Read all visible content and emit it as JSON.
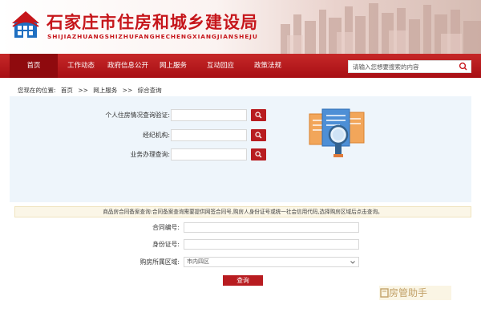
{
  "header": {
    "title": "石家庄市住房和城乡建设局",
    "subtitle": "SHIJIAZHUANGSHIZHUFANGHECHENGXIANGJIANSHEJU"
  },
  "nav": {
    "items": [
      {
        "label": "首页",
        "active": true
      },
      {
        "label": "工作动态"
      },
      {
        "label": "政府信息公开"
      },
      {
        "label": "网上服务"
      },
      {
        "label": "互动回应"
      },
      {
        "label": "政策法规"
      }
    ],
    "search_placeholder": "请输入您想要搜索的内容"
  },
  "breadcrumb": {
    "prefix": "您现在的位置:",
    "items": [
      "首页",
      "网上服务",
      "综合查询"
    ],
    "separator": ">>"
  },
  "query_panel": {
    "rows": [
      {
        "label": "个人住房情况查询验证:",
        "value": ""
      },
      {
        "label": "经纪机构:",
        "value": ""
      },
      {
        "label": "业务办理查询:",
        "value": ""
      }
    ]
  },
  "notice": "商品房合同备案查询:合同备案查询需要提供网签合同号,购房人身份证号或统一社会信用代码,选择购房区域后点击查询。",
  "contract_form": {
    "contract_label": "合同编号:",
    "contract_value": "",
    "id_label": "身份证号:",
    "id_value": "",
    "district_label": "购房所属区域:",
    "district_value": "市内四区",
    "submit_label": "查询"
  },
  "watermark": "房管助手",
  "colors": {
    "brand_red": "#c6161b",
    "nav_red": "#b81c20",
    "panel_bg": "#eef5fb",
    "notice_bg": "#fbf6e7"
  }
}
